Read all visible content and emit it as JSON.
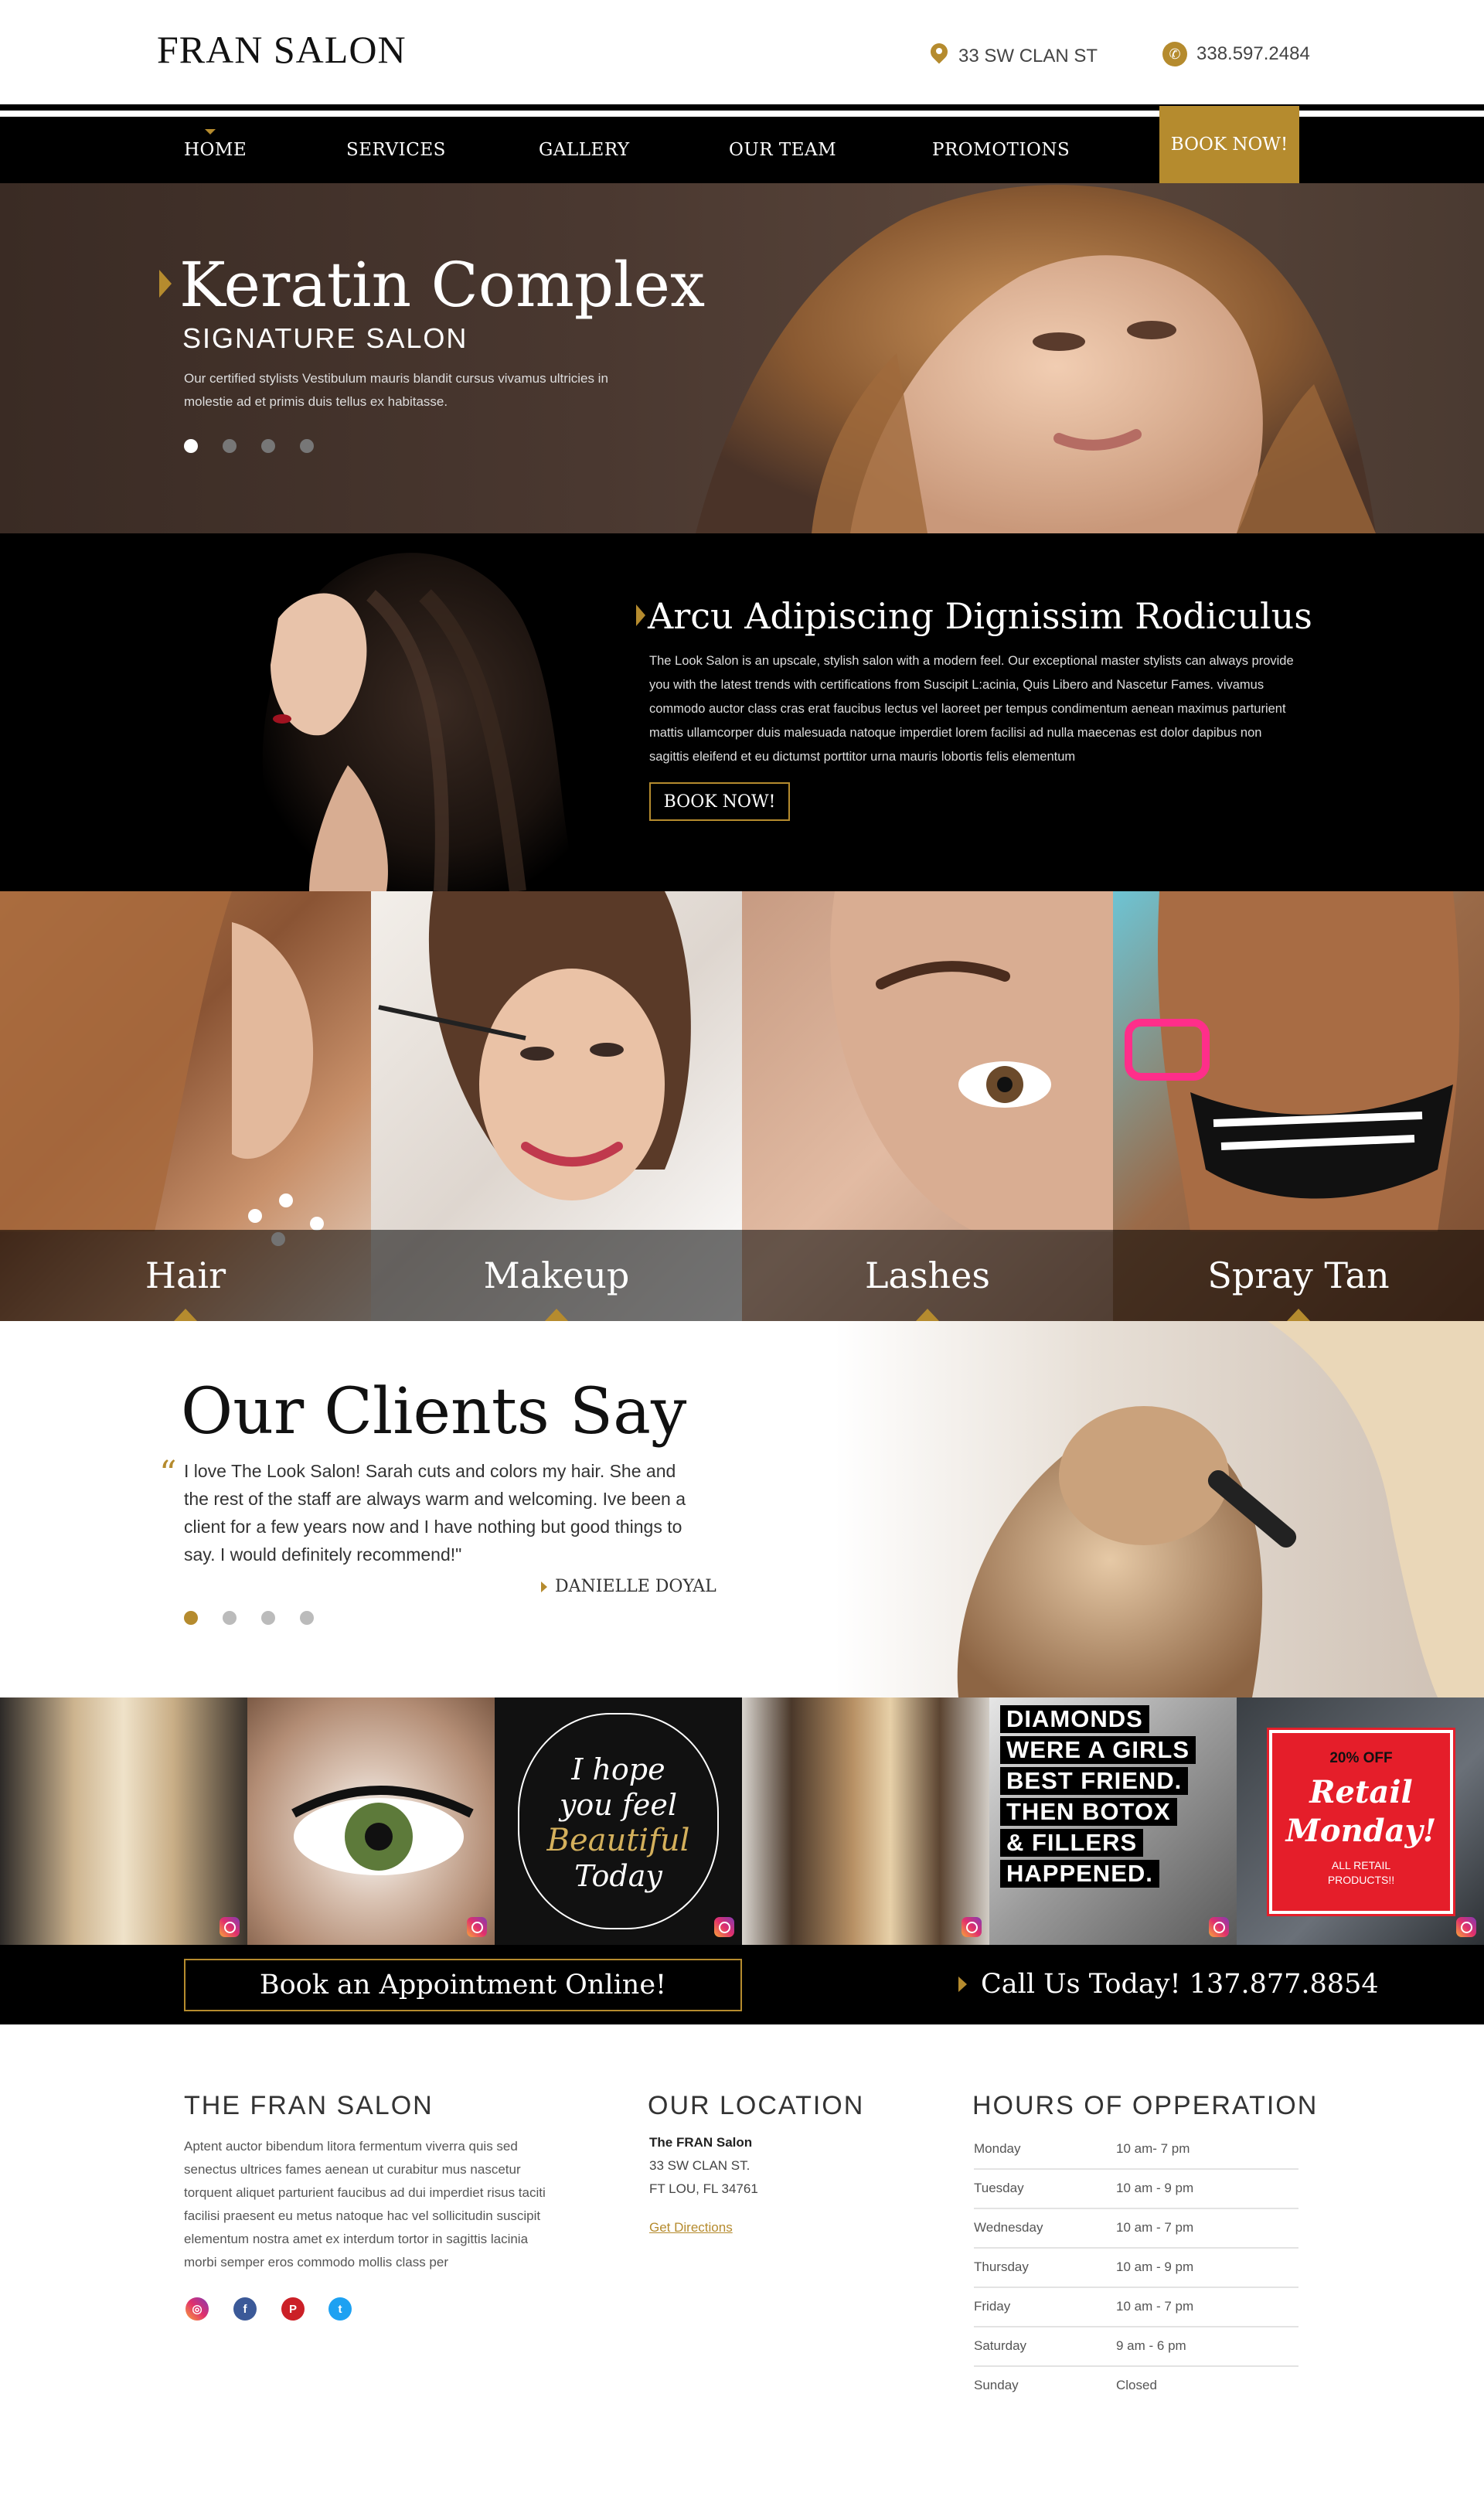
{
  "header": {
    "logo": "FRAN SALON",
    "address": "33 SW CLAN ST",
    "phone": "338.597.2484"
  },
  "nav": {
    "items": [
      "HOME",
      "SERVICES",
      "GALLERY",
      "OUR TEAM",
      "PROMOTIONS"
    ],
    "book_label": "BOOK NOW!"
  },
  "hero": {
    "title": "Keratin Complex",
    "subtitle": "SIGNATURE SALON",
    "description": "Our certified stylists Vestibulum mauris blandit cursus vivamus ultricies in molestie ad et primis duis tellus ex habitasse."
  },
  "about": {
    "title": "Arcu Adipiscing Dignissim Rodiculus",
    "body": "The Look Salon is an upscale, stylish salon with a modern feel. Our exceptional master stylists can always provide you with the latest trends with certifications from Suscipit L:acinia, Quis Libero and Nascetur Fames. vivamus commodo auctor class cras erat faucibus lectus vel laoreet per tempus condimentum aenean maximus parturient mattis ullamcorper duis malesuada natoque imperdiet lorem facilisi ad nulla maecenas est dolor dapibus non sagittis eleifend et eu dictumst porttitor urna mauris lobortis felis elementum",
    "button": "BOOK NOW!"
  },
  "services": [
    "Hair",
    "Makeup",
    "Lashes",
    "Spray Tan"
  ],
  "testimonials": {
    "title": "Our Clients Say",
    "quote": "I love The Look Salon! Sarah cuts and colors my hair. She and the rest of the staff are always warm and welcoming. Ive been a client for a few years now and I have nothing but good things to say. I would definitely recommend!\"",
    "author": "DANIELLE DOYAL"
  },
  "instagram": {
    "quote_lines": [
      "I hope",
      "you feel",
      "Beautiful",
      "Today"
    ],
    "diamonds_lines": [
      "DIAMONDS",
      "WERE A GIRLS",
      "BEST FRIEND.",
      "THEN BOTOX",
      "& FILLERS",
      "HAPPENED."
    ],
    "promo_top": "20% OFF",
    "promo_main": "Retail Monday!",
    "promo_bottom": "ALL RETAIL PRODUCTS!!"
  },
  "cta": {
    "book": "Book an Appointment Online!",
    "call": "Call Us Today! 137.877.8854"
  },
  "footer": {
    "about_title": "THE FRAN SALON",
    "about_text": "Aptent auctor bibendum litora fermentum viverra quis sed senectus ultrices fames aenean ut curabitur mus nascetur torquent aliquet parturient faucibus ad dui imperdiet risus taciti facilisi praesent eu metus natoque hac vel sollicitudin suscipit elementum nostra amet ex interdum tortor in sagittis lacinia morbi semper eros commodo mollis class per",
    "location_title": "OUR LOCATION",
    "location_name": "The FRAN Salon",
    "location_street": "33 SW CLAN ST.",
    "location_city": "FT LOU, FL 34761",
    "directions": "Get Directions",
    "hours_title": "HOURS OF OPPERATION",
    "hours": [
      {
        "day": "Monday",
        "time": "10 am- 7 pm"
      },
      {
        "day": "Tuesday",
        "time": "10 am - 9 pm"
      },
      {
        "day": "Wednesday",
        "time": "10 am - 7 pm"
      },
      {
        "day": "Thursday",
        "time": "10 am - 9 pm"
      },
      {
        "day": "Friday",
        "time": "10 am - 7 pm"
      },
      {
        "day": "Saturday",
        "time": "9 am - 6 pm"
      },
      {
        "day": "Sunday",
        "time": "Closed"
      }
    ]
  },
  "colors": {
    "accent": "#b58b2e",
    "black": "#000000"
  }
}
